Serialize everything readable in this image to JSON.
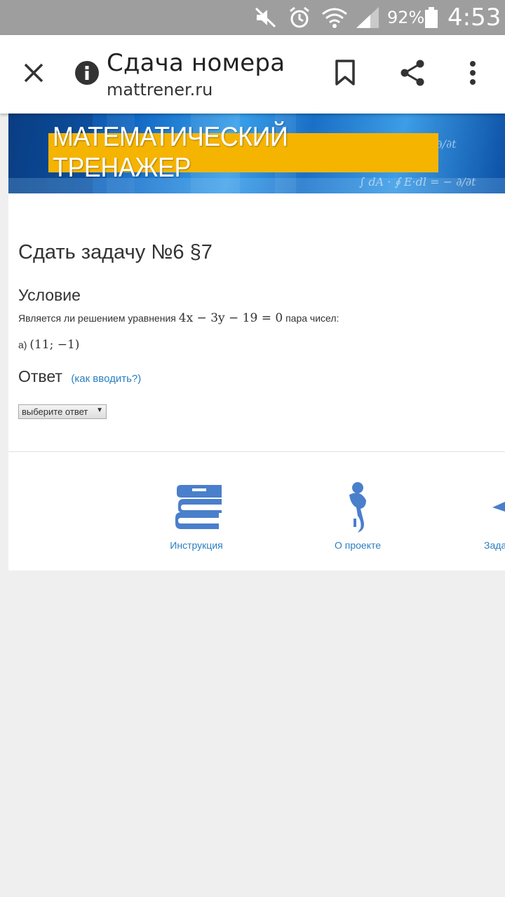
{
  "status_bar": {
    "battery_percent": "92%",
    "time": "4:53",
    "icons": [
      "mute-icon",
      "alarm-icon",
      "wifi-icon",
      "signal-icon",
      "battery-icon"
    ]
  },
  "toolbar": {
    "title": "Сдача номера",
    "url": "mattrener.ru",
    "icons": [
      "close-icon",
      "info-icon",
      "bookmark-icon",
      "share-icon",
      "more-icon"
    ]
  },
  "banner": {
    "title": "МАТЕМАТИЧЕСКИЙ ТРЕНАЖЕР",
    "colors": {
      "accent": "#f5b400",
      "sky": "#1168c4"
    }
  },
  "task": {
    "title": "Сдать задачу №6 §7",
    "condition_heading": "Условие",
    "condition_text_before": "Является ли решением уравнения",
    "equation": "4x − 3y − 19 = 0",
    "condition_text_after": "пара чисел:",
    "part_label": "а)",
    "pair": "(11; −1)"
  },
  "answer": {
    "heading": "Ответ",
    "how_to_link": "(как вводить?)",
    "select_value": "выберите ответ"
  },
  "footer": {
    "items": [
      {
        "label": "Инструкция",
        "icon": "books-icon"
      },
      {
        "label": "О проекте",
        "icon": "about-icon"
      },
      {
        "label": "Зада",
        "icon": "task-icon"
      }
    ],
    "icon_color": "#4a7fcb"
  }
}
